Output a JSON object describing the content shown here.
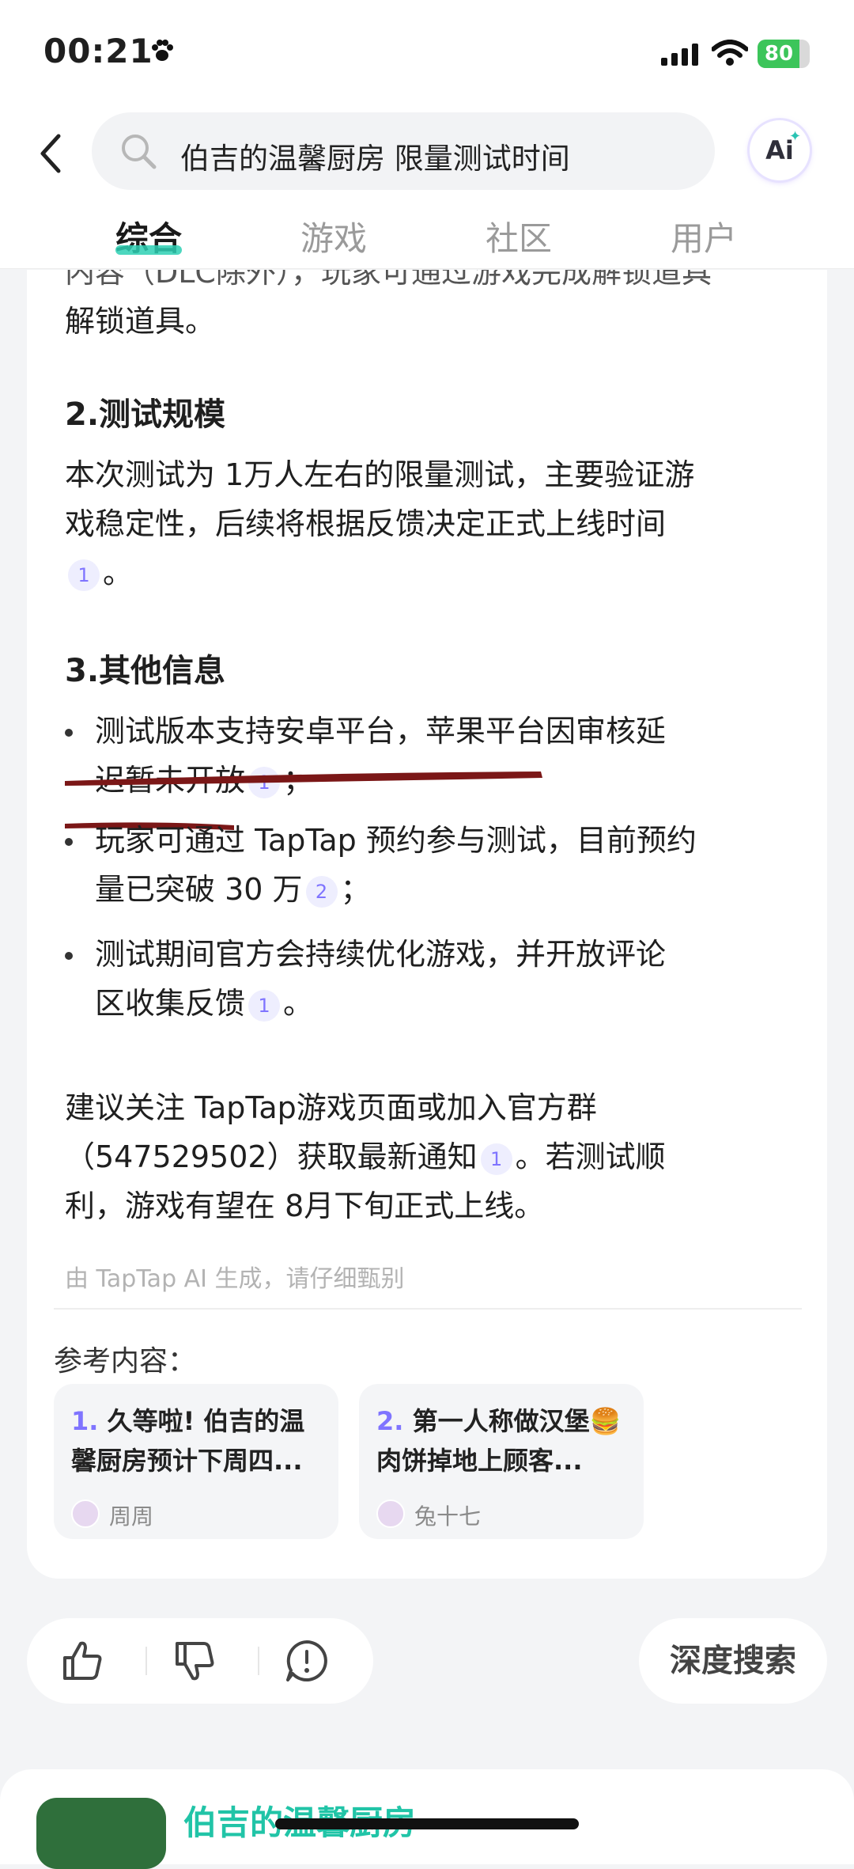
{
  "status_bar": {
    "time": "00:21",
    "battery": "80",
    "battery_level_percent": 80,
    "icons": [
      "paw-icon",
      "signal-icon",
      "wifi-icon",
      "battery-icon"
    ]
  },
  "search": {
    "query": "伯吉的温馨厨房 限量测试时间",
    "ai_label": "Ai"
  },
  "tabs": [
    {
      "label": "综合",
      "active": true
    },
    {
      "label": "游戏",
      "active": false
    },
    {
      "label": "社区",
      "active": false
    },
    {
      "label": "用户",
      "active": false
    }
  ],
  "answer": {
    "cut_off_top": "内容（DLC除外），玩家可通过游戏完成解锁道具",
    "cut_off_line2": "解锁道具。",
    "section2_title": "2.测试规模",
    "section2_text1": "本次测试为 1万人左右的限量测试，主要验证游",
    "section2_text2": "戏稳定性，后续将根据反馈决定正式上线时间",
    "section2_text3": "。",
    "section3_title": "3.其他信息",
    "bullet1_line1": "测试版本支持安卓平台，苹果平台因审核延",
    "bullet1_line2": "迟暂未开放",
    "bullet1_end": "；",
    "bullet2_line1": "玩家可通过 TapTap 预约参与测试，目前预约",
    "bullet2_line2": "量已突破 30 万",
    "bullet2_end": "；",
    "bullet3_line1": "测试期间官方会持续优化游戏，并开放评论",
    "bullet3_line2": "区收集反馈",
    "bullet3_end": "。",
    "closing_line1": "建议关注 TapTap游戏页面或加入官方群",
    "closing_line2a": "（547529502）获取最新通知",
    "closing_line2b": "。若测试顺",
    "closing_line3": "利，游戏有望在 8月下旬正式上线。",
    "disclaimer": "由 TapTap AI 生成，请仔细甄别",
    "cite_1": "1",
    "cite_2": "2"
  },
  "references": {
    "title": "参考内容：",
    "items": [
      {
        "num": "1.",
        "text": "久等啦! 伯吉的温馨厨房预计下周四...",
        "author": "周周"
      },
      {
        "num": "2.",
        "text": "第一人称做汉堡🍔肉饼掉地上顾客...",
        "author": "兔十七"
      }
    ]
  },
  "feedback": {
    "icons": [
      "thumbs-up-icon",
      "thumbs-down-icon",
      "report-icon"
    ],
    "deep_search_label": "深度搜索"
  },
  "bottom_card": {
    "title": "伯吉的温馨厨房"
  },
  "colors": {
    "accent": "#2ed0b4",
    "cite_bg": "#eeeefe",
    "cite_fg": "#7f74ff",
    "underline_red": "#7b1717"
  }
}
